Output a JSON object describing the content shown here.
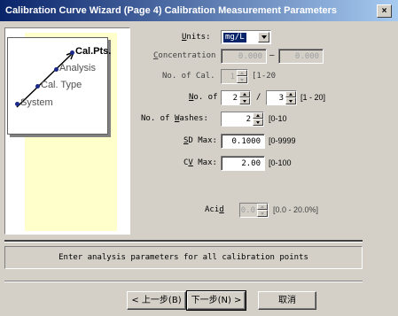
{
  "window": {
    "title": "Calibration Curve Wizard (Page 4) Calibration Measurement Parameters",
    "close_glyph": "×"
  },
  "steps": {
    "items": [
      {
        "label": "Cal.Pts.",
        "bold": true
      },
      {
        "label": "Analysis",
        "bold": false
      },
      {
        "label": "Cal. Type",
        "bold": false
      },
      {
        "label": "System",
        "bold": false
      }
    ],
    "line_color": "#000000",
    "bullet_color": "#1a2a8a"
  },
  "form": {
    "units": {
      "label_pre": "",
      "label_key": "U",
      "label_post": "nits:",
      "value": "mg/L"
    },
    "concentration": {
      "label_pre": "",
      "label_key": "C",
      "label_post": "oncentration",
      "from": "0.000",
      "separator": "—",
      "to": "0.000"
    },
    "no_of_cal": {
      "label": "No. of Cal.",
      "value": "1",
      "range": "[1-20"
    },
    "no_of": {
      "label_pre": "",
      "label_key": "N",
      "label_post": "o. of",
      "value_a": "2",
      "separator": "/",
      "value_b": "3",
      "range": "[1 - 20]"
    },
    "no_of_washes": {
      "label_pre": "No. of ",
      "label_key": "W",
      "label_post": "ashes:",
      "value": "2",
      "range": "[0-10"
    },
    "sd_max": {
      "label_pre": "",
      "label_key": "S",
      "label_post": "D Max:",
      "value": "0.1000",
      "range": "[0-9999"
    },
    "cv_max": {
      "label_pre": "C",
      "label_key": "V",
      "label_post": " Max:",
      "value": "2.00",
      "range": "[0-100"
    },
    "acid": {
      "label_pre": "Aci",
      "label_key": "d",
      "label_post": "",
      "value": "0.0",
      "range": "[0.0 - 20.0%]"
    }
  },
  "status": {
    "message": "Enter analysis parameters for all calibration points"
  },
  "buttons": {
    "back": "< 上一步(B)",
    "next": "下一步(N) >",
    "cancel": "取消"
  },
  "colors": {
    "title_start": "#0a246a",
    "title_end": "#a6caf0",
    "panel_yellow": "#ffffcc",
    "face": "#d4d0c8"
  }
}
